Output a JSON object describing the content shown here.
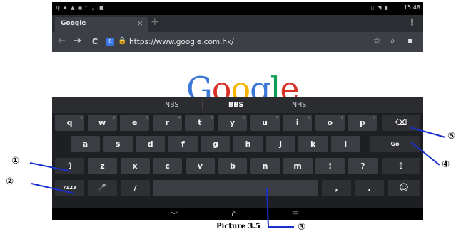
{
  "status_bar": {
    "time": "15:48"
  },
  "tab": {
    "title": "Google",
    "close": "×",
    "new_tab": "+"
  },
  "menu_icon": "⋮",
  "url_bar": {
    "back": "←",
    "forward": "→",
    "reload": "C",
    "lock": "🔒",
    "url": "https://www.google.com.hk/",
    "star": "☆",
    "search": "⌕",
    "bookmark": "▪"
  },
  "page": {
    "logo_letters": [
      "G",
      "o",
      "o",
      "g",
      "l",
      "e"
    ],
    "logo_colors": [
      "#3c78d8",
      "#d93025",
      "#f4b400",
      "#3c78d8",
      "#0f9d58",
      "#d93025"
    ]
  },
  "suggestions": [
    "NBS",
    "BBS",
    "NHS"
  ],
  "keyboard": {
    "row1": [
      "q",
      "w",
      "e",
      "r",
      "t",
      "y",
      "u",
      "i",
      "o",
      "p"
    ],
    "row1_hints": [
      "1",
      "2",
      "3",
      "4",
      "5",
      "6",
      "7",
      "8",
      "9",
      "0"
    ],
    "backspace": "⌫",
    "row2": [
      "a",
      "s",
      "d",
      "f",
      "g",
      "h",
      "j",
      "k",
      "l"
    ],
    "go": "Go",
    "shift": "⇧",
    "row3": [
      "z",
      "x",
      "c",
      "v",
      "b",
      "n",
      "m",
      "!",
      "?"
    ],
    "symbols": "?123",
    "mic": "🎤",
    "slash": "/",
    "comma": ",",
    "period": ".",
    "emoji": "☺"
  },
  "nav_bar": {
    "back": "﹀",
    "home": "⌂",
    "recents": "▭"
  },
  "callouts": [
    "①",
    "②",
    "③",
    "④",
    "⑤"
  ],
  "caption": "Picture 3.5"
}
